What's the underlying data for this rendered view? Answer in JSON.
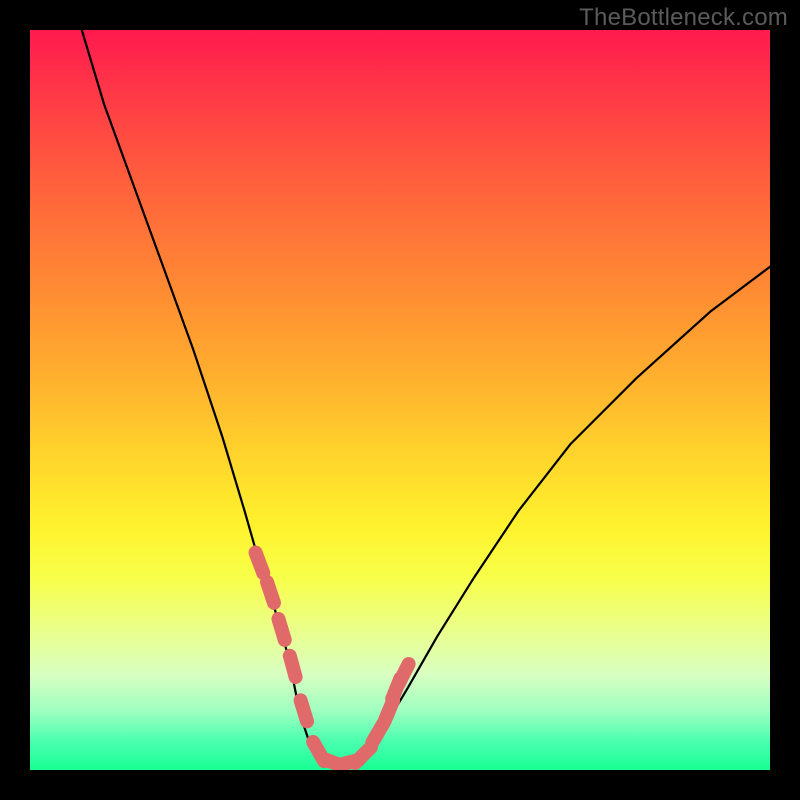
{
  "watermark": "TheBottleneck.com",
  "chart_data": {
    "type": "line",
    "title": "",
    "xlabel": "",
    "ylabel": "",
    "xlim": [
      0,
      100
    ],
    "ylim": [
      0,
      100
    ],
    "grid": false,
    "legend": false,
    "series": [
      {
        "name": "main-curve",
        "color": "#000000",
        "x": [
          7,
          10,
          14,
          18,
          22,
          26,
          29,
          31,
          33,
          35,
          36,
          37,
          38,
          40,
          42,
          44,
          46,
          48,
          51,
          55,
          60,
          66,
          73,
          82,
          92,
          100
        ],
        "y": [
          100,
          90,
          79,
          68,
          57,
          45,
          35,
          28,
          22,
          15,
          10,
          6,
          3,
          1,
          1,
          1,
          3,
          6,
          11,
          18,
          26,
          35,
          44,
          53,
          62,
          68
        ]
      },
      {
        "name": "highlight-segments",
        "color": "#e06a6a",
        "type": "scatter",
        "x": [
          31,
          32.5,
          34,
          35.5,
          37,
          39,
          41,
          43,
          45,
          47,
          48.5,
          49.5,
          50.5
        ],
        "y": [
          28,
          24,
          19,
          14,
          8,
          2.5,
          1,
          1,
          2,
          5,
          8,
          11,
          13
        ]
      }
    ],
    "annotations": []
  }
}
